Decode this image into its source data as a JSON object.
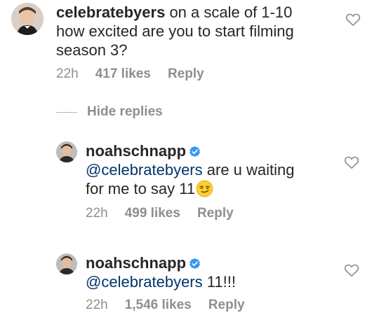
{
  "comments": [
    {
      "username": "celebratebyers",
      "text_line1": " on a scale of 1-10",
      "text_line2": "how excited are you to start filming",
      "text_line3": "season 3?",
      "time": "22h",
      "likes": "417 likes",
      "reply": "Reply"
    }
  ],
  "hide_replies": "Hide replies",
  "replies": [
    {
      "username": "noahschnapp",
      "mention": "@celebratebyers",
      "text_line1": " are u waiting",
      "text_line2": "for me to say 11",
      "time": "22h",
      "likes": "499 likes",
      "reply": "Reply"
    },
    {
      "username": "noahschnapp",
      "mention": "@celebratebyers",
      "text_line1": " 11!!!",
      "time": "22h",
      "likes": "1,546 likes",
      "reply": "Reply"
    }
  ],
  "colors": {
    "text": "#262626",
    "mention": "#003569",
    "meta": "#8e8e8e",
    "verified": "#3897f0"
  },
  "icons": {
    "like": "heart-outline-icon",
    "verified": "verified-badge-icon",
    "emoji": "smirking-face-emoji"
  }
}
